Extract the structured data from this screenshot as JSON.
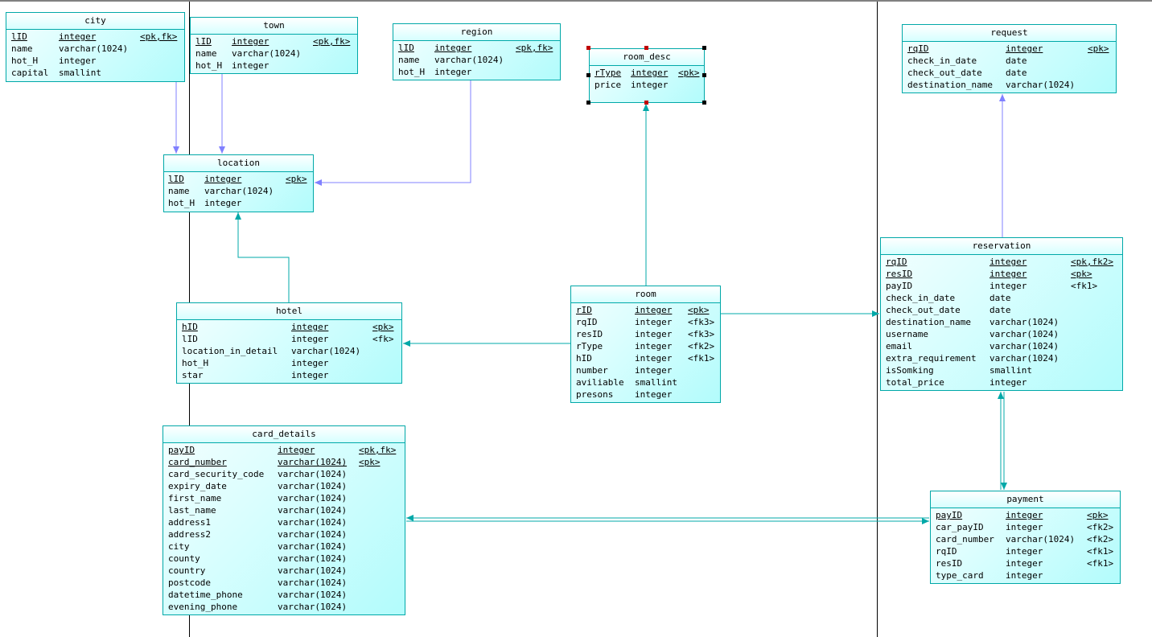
{
  "colors": {
    "border": "#00a8a8",
    "fk_link": "#8080ff",
    "ref_link": "#00a8a8"
  },
  "tables": [
    {
      "name": "city",
      "columns": [
        [
          "lID",
          "integer",
          "<pk,fk>",
          true
        ],
        [
          "name",
          "varchar(1024)",
          "",
          false
        ],
        [
          "hot_H",
          "integer",
          "",
          false
        ],
        [
          "capital",
          "smallint",
          "",
          false
        ]
      ]
    },
    {
      "name": "town",
      "columns": [
        [
          "lID",
          "integer",
          "<pk,fk>",
          true
        ],
        [
          "name",
          "varchar(1024)",
          "",
          false
        ],
        [
          "hot_H",
          "integer",
          "",
          false
        ]
      ]
    },
    {
      "name": "region",
      "columns": [
        [
          "lID",
          "integer",
          "<pk,fk>",
          true
        ],
        [
          "name",
          "varchar(1024)",
          "",
          false
        ],
        [
          "hot_H",
          "integer",
          "",
          false
        ]
      ]
    },
    {
      "name": "room_desc",
      "columns": [
        [
          "rType",
          "integer",
          "<pk>",
          true
        ],
        [
          "price",
          "integer",
          "",
          false
        ]
      ]
    },
    {
      "name": "location",
      "columns": [
        [
          "lID",
          "integer",
          "<pk>",
          true
        ],
        [
          "name",
          "varchar(1024)",
          "",
          false
        ],
        [
          "hot_H",
          "integer",
          "",
          false
        ]
      ]
    },
    {
      "name": "hotel",
      "columns": [
        [
          "hID",
          "integer",
          "<pk>",
          true
        ],
        [
          "lID",
          "integer",
          "<fk>",
          false
        ],
        [
          "location_in_detail",
          "varchar(1024)",
          "",
          false
        ],
        [
          "hot_H",
          "integer",
          "",
          false
        ],
        [
          "star",
          "integer",
          "",
          false
        ]
      ]
    },
    {
      "name": "room",
      "columns": [
        [
          "rID",
          "integer",
          "<pk>",
          true
        ],
        [
          "rqID",
          "integer",
          "<fk3>",
          false
        ],
        [
          "resID",
          "integer",
          "<fk3>",
          false
        ],
        [
          "rType",
          "integer",
          "<fk2>",
          false
        ],
        [
          "hID",
          "integer",
          "<fk1>",
          false
        ],
        [
          "number",
          "integer",
          "",
          false
        ],
        [
          "aviliable",
          "smallint",
          "",
          false
        ],
        [
          "presons",
          "integer",
          "",
          false
        ]
      ]
    },
    {
      "name": "request",
      "columns": [
        [
          "rqID",
          "integer",
          "<pk>",
          true
        ],
        [
          "check_in_date",
          "date",
          "",
          false
        ],
        [
          "check_out_date",
          "date",
          "",
          false
        ],
        [
          "destination_name",
          "varchar(1024)",
          "",
          false
        ]
      ]
    },
    {
      "name": "reservation",
      "columns": [
        [
          "rqID",
          "integer",
          "<pk,fk2>",
          true
        ],
        [
          "resID",
          "integer",
          "<pk>",
          true
        ],
        [
          "payID",
          "integer",
          "<fk1>",
          false
        ],
        [
          "check_in_date",
          "date",
          "",
          false
        ],
        [
          "check_out_date",
          "date",
          "",
          false
        ],
        [
          "destination_name",
          "varchar(1024)",
          "",
          false
        ],
        [
          "username",
          "varchar(1024)",
          "",
          false
        ],
        [
          "email",
          "varchar(1024)",
          "",
          false
        ],
        [
          "extra_requirement",
          "varchar(1024)",
          "",
          false
        ],
        [
          "isSomking",
          "smallint",
          "",
          false
        ],
        [
          "total_price",
          "integer",
          "",
          false
        ]
      ]
    },
    {
      "name": "card_details",
      "columns": [
        [
          "payID",
          "integer",
          "<pk,fk>",
          true
        ],
        [
          "card_number",
          "varchar(1024)",
          "<pk>",
          true
        ],
        [
          "card_security_code",
          "varchar(1024)",
          "",
          false
        ],
        [
          "expiry_date",
          "varchar(1024)",
          "",
          false
        ],
        [
          "first_name",
          "varchar(1024)",
          "",
          false
        ],
        [
          "last_name",
          "varchar(1024)",
          "",
          false
        ],
        [
          "address1",
          "varchar(1024)",
          "",
          false
        ],
        [
          "address2",
          "varchar(1024)",
          "",
          false
        ],
        [
          "city",
          "varchar(1024)",
          "",
          false
        ],
        [
          "county",
          "varchar(1024)",
          "",
          false
        ],
        [
          "country",
          "varchar(1024)",
          "",
          false
        ],
        [
          "postcode",
          "varchar(1024)",
          "",
          false
        ],
        [
          "datetime_phone",
          "varchar(1024)",
          "",
          false
        ],
        [
          "evening_phone",
          "varchar(1024)",
          "",
          false
        ]
      ]
    },
    {
      "name": "payment",
      "columns": [
        [
          "payID",
          "integer",
          "<pk>",
          true
        ],
        [
          "car_payID",
          "integer",
          "<fk2>",
          false
        ],
        [
          "card_number",
          "varchar(1024)",
          "<fk2>",
          false
        ],
        [
          "rqID",
          "integer",
          "<fk1>",
          false
        ],
        [
          "resID",
          "integer",
          "<fk1>",
          false
        ],
        [
          "type_card",
          "integer",
          "",
          false
        ]
      ]
    }
  ],
  "selected_table": "room_desc"
}
